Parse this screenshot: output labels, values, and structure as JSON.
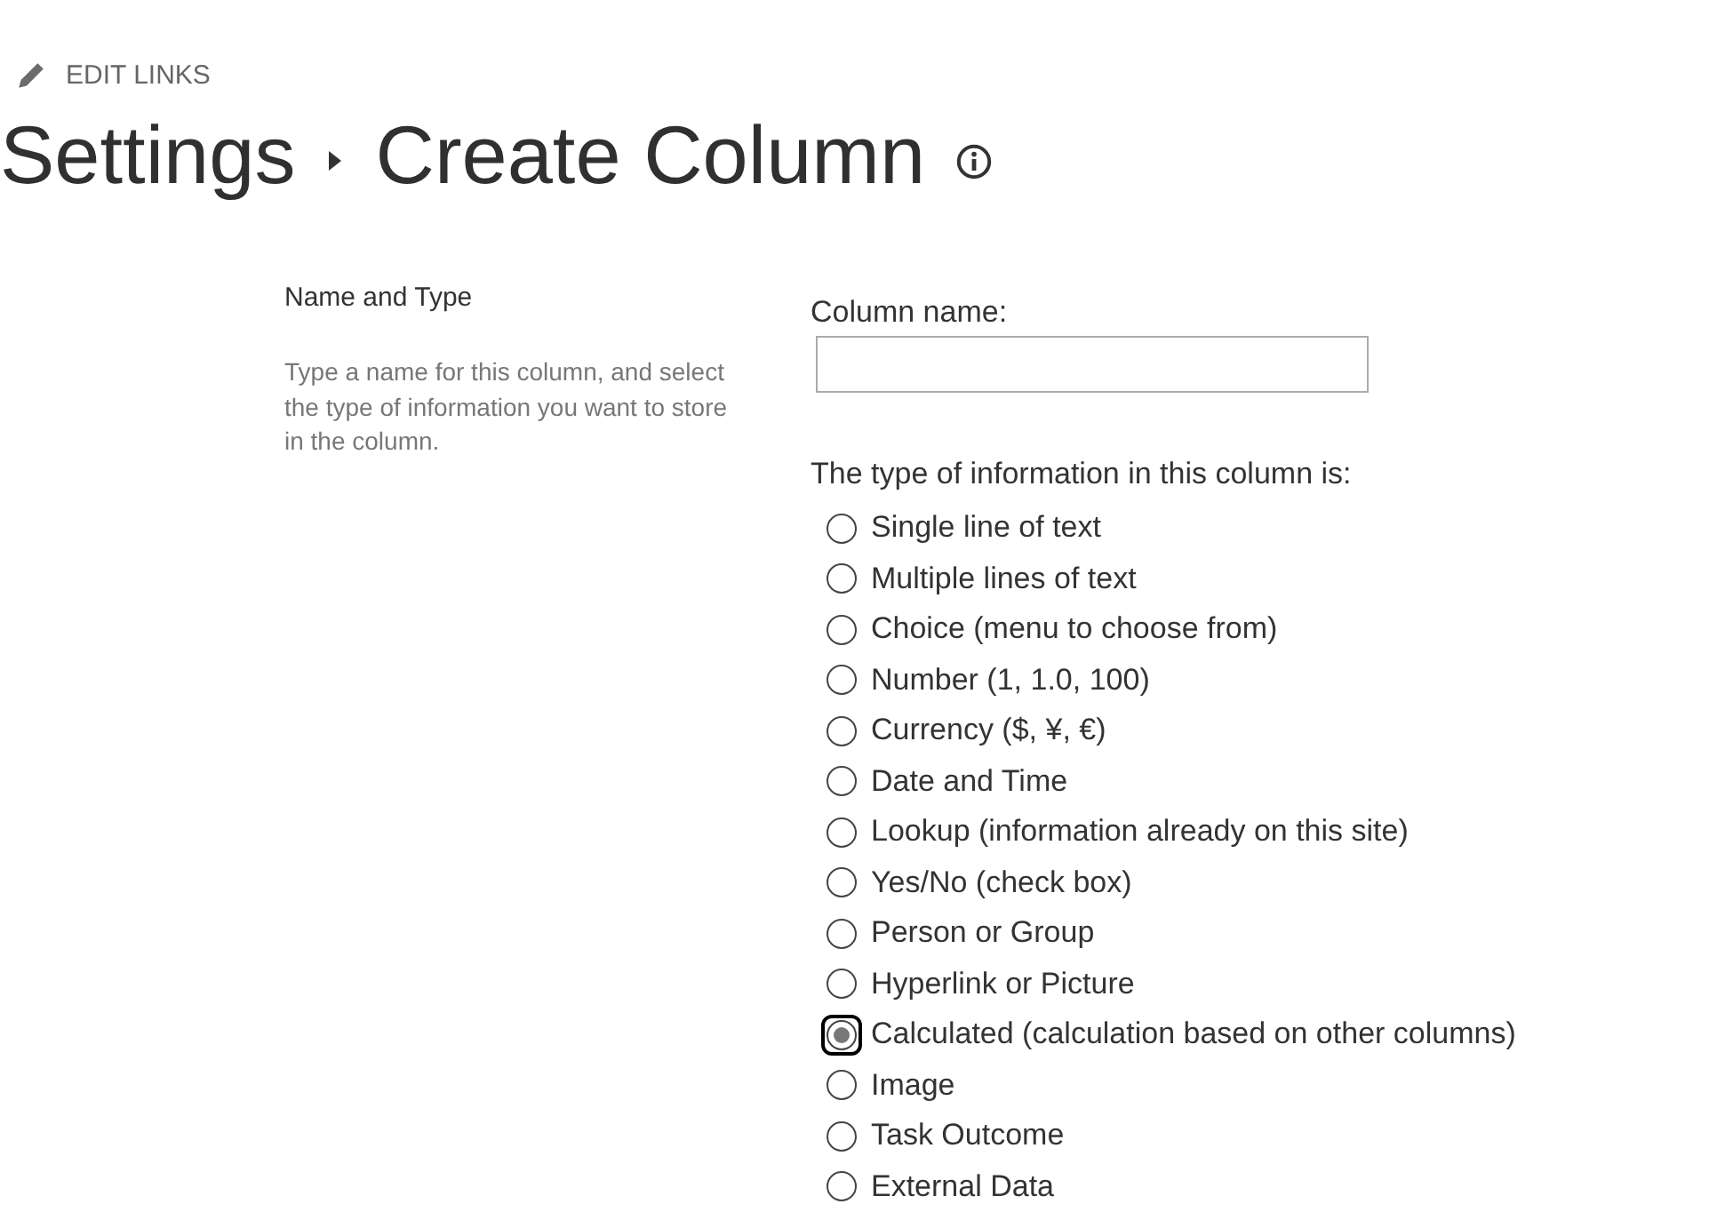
{
  "edit_links": {
    "label": "EDIT LINKS"
  },
  "breadcrumb": [
    {
      "label": "Settings"
    },
    {
      "label": "Create Column"
    }
  ],
  "section": {
    "title": "Name and Type",
    "description": "Type a name for this column, and select the type of information you want to store in the column."
  },
  "column_name": {
    "label": "Column name:"
  },
  "column_type": {
    "label": "The type of information in this column is:",
    "options": [
      {
        "label": "Single line of text",
        "selected": false
      },
      {
        "label": "Multiple lines of text",
        "selected": false
      },
      {
        "label": "Choice (menu to choose from)",
        "selected": false
      },
      {
        "label": "Number (1, 1.0, 100)",
        "selected": false
      },
      {
        "label": "Currency ($, ¥, €)",
        "selected": false
      },
      {
        "label": "Date and Time",
        "selected": false
      },
      {
        "label": "Lookup (information already on this site)",
        "selected": false
      },
      {
        "label": "Yes/No (check box)",
        "selected": false
      },
      {
        "label": "Person or Group",
        "selected": false
      },
      {
        "label": "Hyperlink or Picture",
        "selected": false
      },
      {
        "label": "Calculated (calculation based on other columns)",
        "selected": true
      },
      {
        "label": "Image",
        "selected": false
      },
      {
        "label": "Task Outcome",
        "selected": false
      },
      {
        "label": "External Data",
        "selected": false
      }
    ]
  }
}
